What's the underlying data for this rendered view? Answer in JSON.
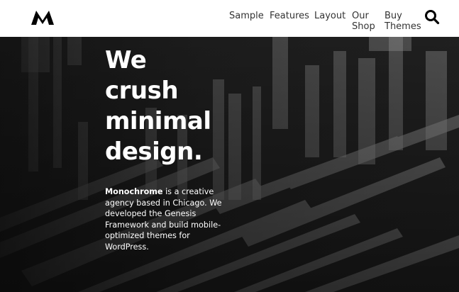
{
  "header": {
    "logo_icon": "monochrome-m-logo",
    "nav": [
      {
        "label_lines": [
          "Sample"
        ]
      },
      {
        "label_lines": [
          "Features"
        ]
      },
      {
        "label_lines": [
          "Layout"
        ]
      },
      {
        "label_lines": [
          "Our",
          "Shop"
        ]
      },
      {
        "label_lines": [
          "Buy",
          "Themes"
        ]
      }
    ],
    "search_icon": "search-icon"
  },
  "hero": {
    "title_lines": [
      "We",
      "crush",
      "minimal",
      "design."
    ],
    "description_bold": "Monochrome",
    "description_rest": " is a creative agency based in Chicago. We developed the Genesis Framework and build mobile-optimized themes for WordPress."
  },
  "colors": {
    "header_bg": "#ffffff",
    "nav_text": "#333333",
    "hero_bg": "#1c1c1c",
    "hero_text": "#ffffff"
  }
}
